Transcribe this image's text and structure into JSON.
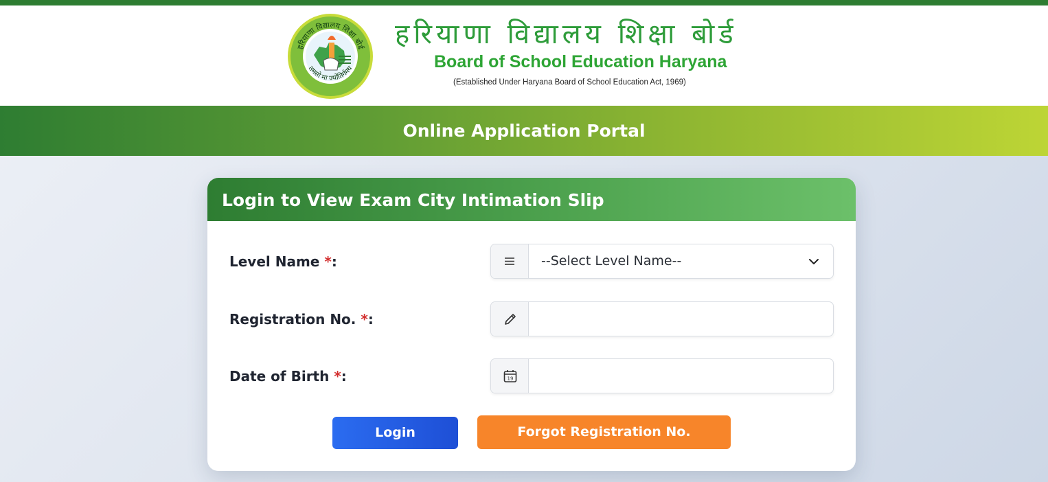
{
  "header": {
    "hindi_title": "हरियाणा विद्यालय शिक्षा बोर्ड",
    "english_title": "Board of School Education Haryana",
    "established": "(Established Under Haryana Board of School Education Act, 1969)",
    "logo_icon": "board-seal-icon",
    "logo_ring_text": "हरियाणा विद्यालय शिक्षा बोर्ड",
    "logo_motto": "तमसो मा ज्योतिर्गमय"
  },
  "banner": {
    "title": "Online Application Portal"
  },
  "form": {
    "title": "Login to View Exam City Intimation Slip",
    "required_mark": "*",
    "level": {
      "label": "Level Name",
      "suffix": ":",
      "selected": "--Select Level Name--",
      "icon": "list-icon"
    },
    "registration": {
      "label": "Registration No.",
      "suffix": ":",
      "value": "",
      "icon": "pencil-icon"
    },
    "dob": {
      "label": "Date of Birth",
      "suffix": ":",
      "value": "",
      "icon": "calendar-icon",
      "calendar_day": "19"
    },
    "login_label": "Login",
    "forgot_label": "Forgot Registration No."
  },
  "colors": {
    "primary_green": "#2e7d32",
    "login_blue": "#2b6cf0",
    "forgot_orange": "#f7852a",
    "required_red": "#d32f2f"
  }
}
